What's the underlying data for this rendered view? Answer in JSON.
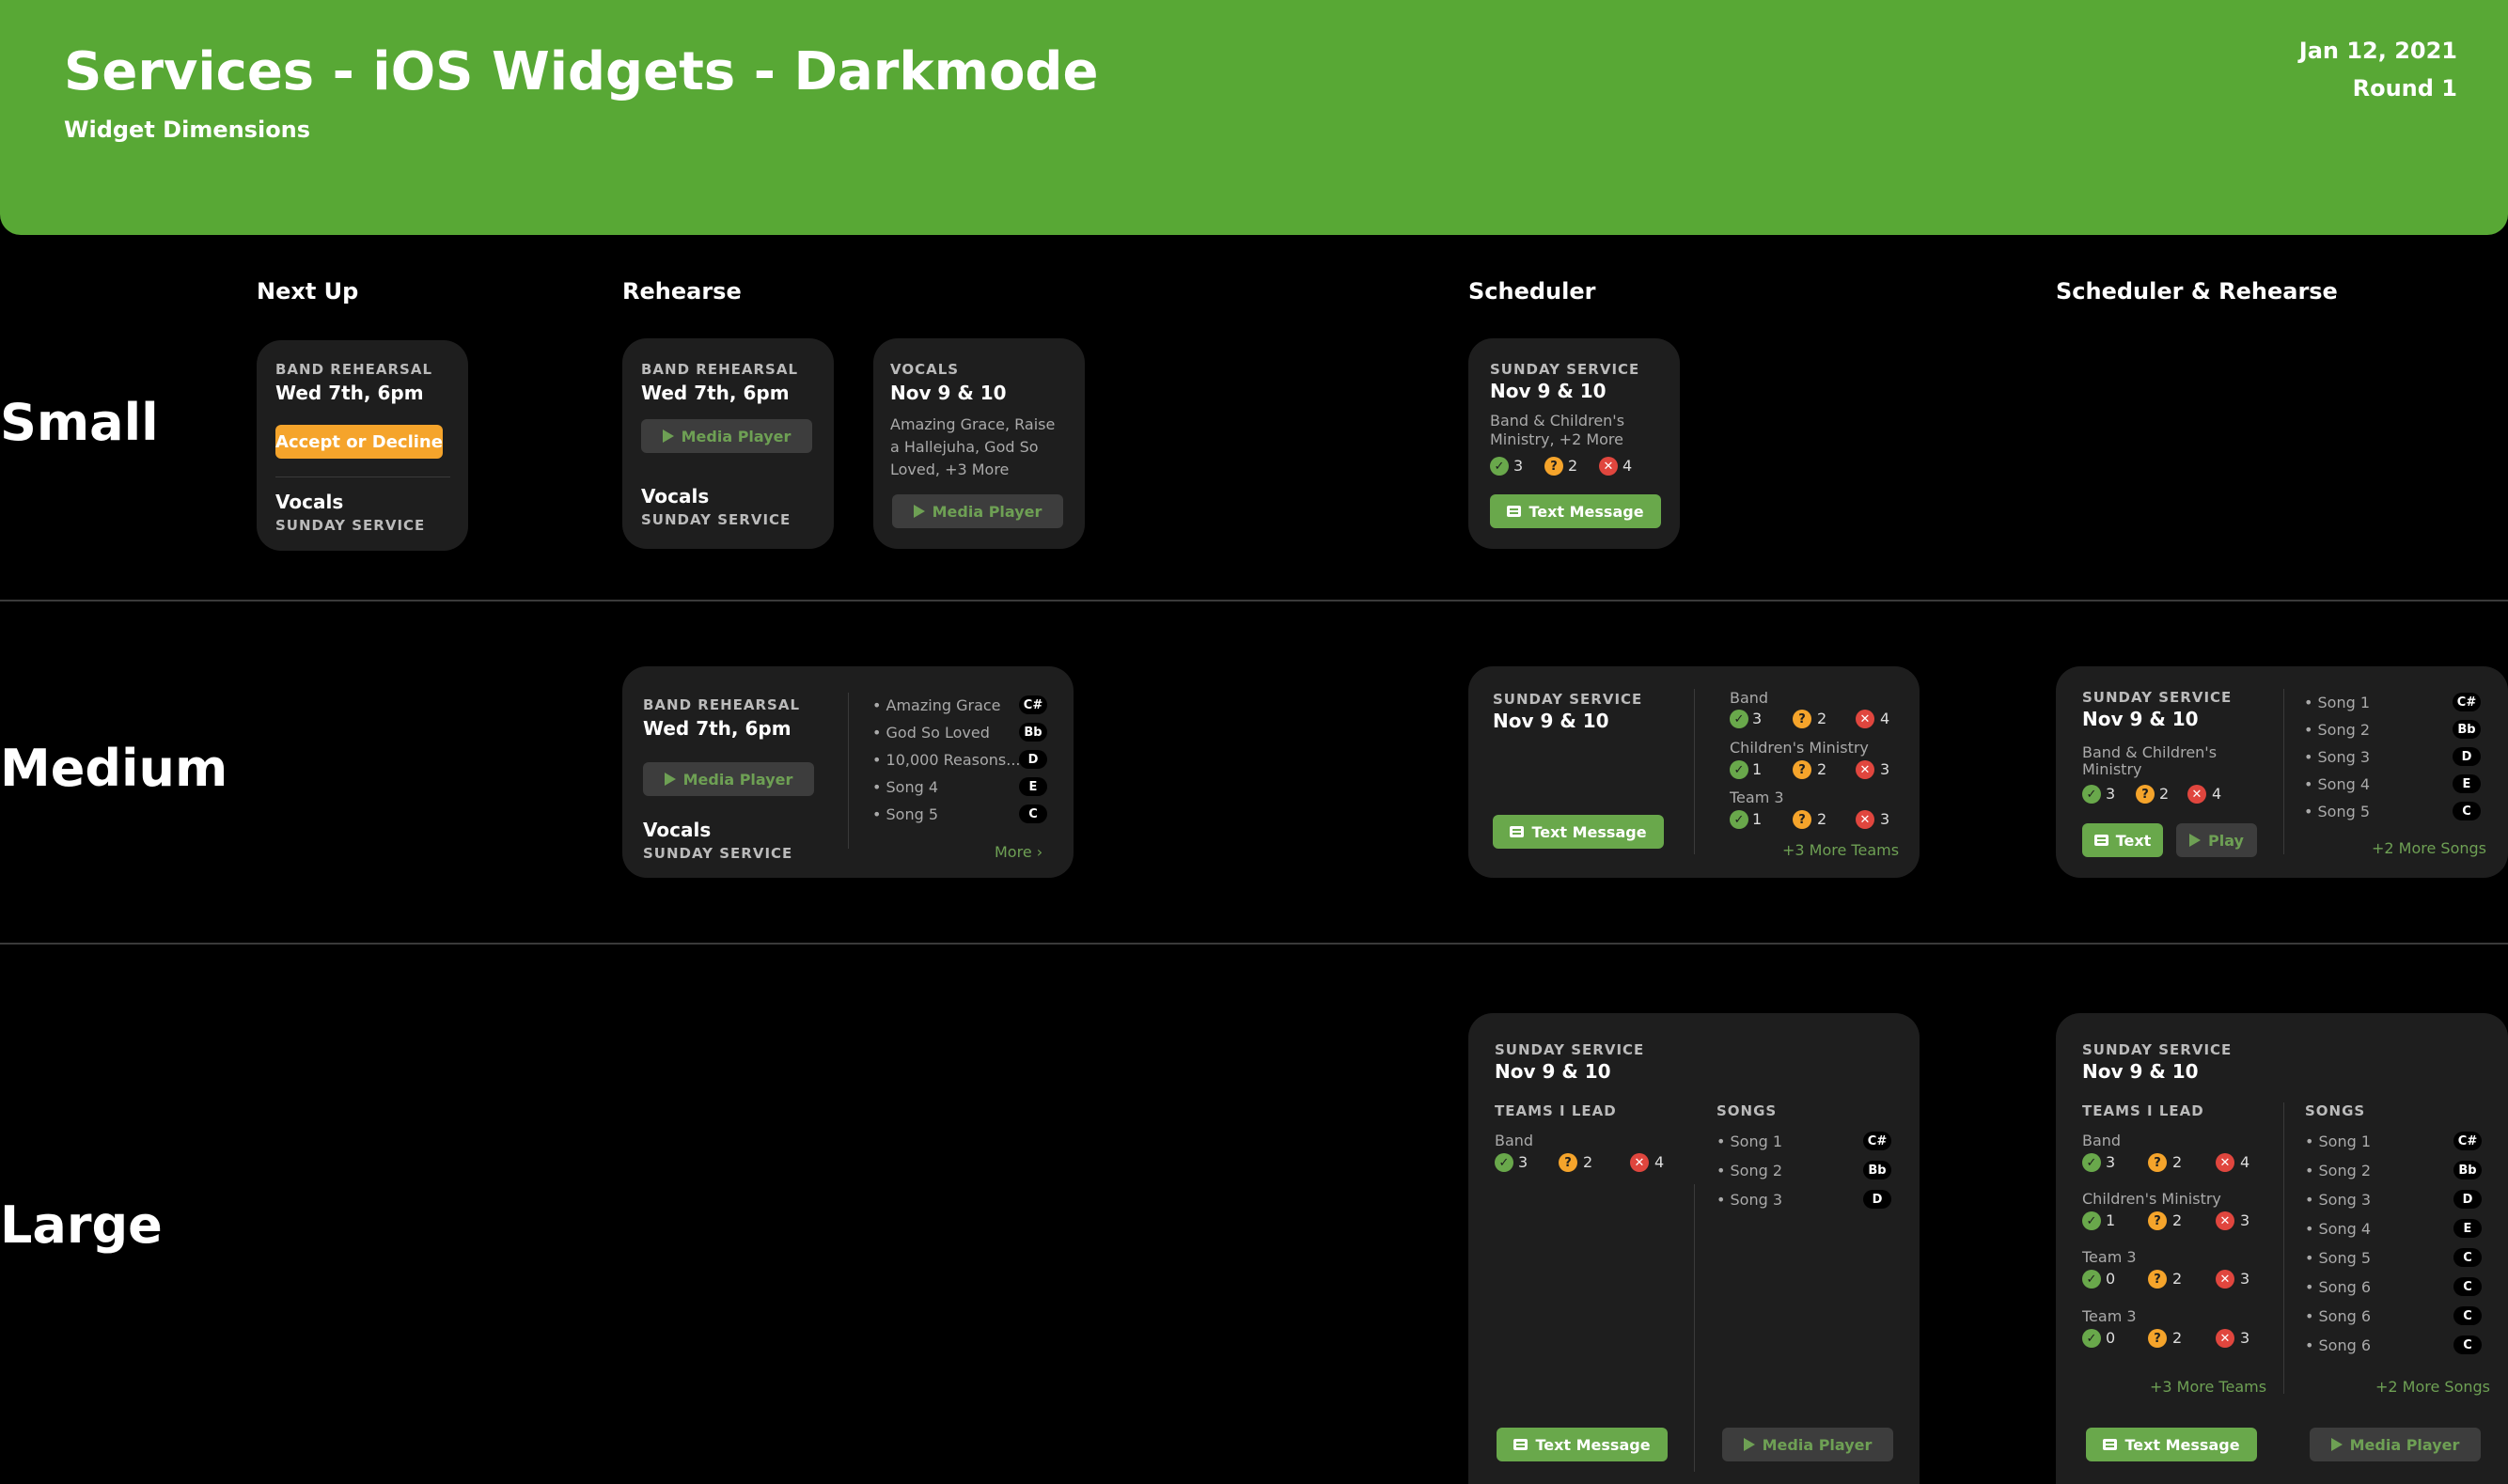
{
  "header": {
    "title": "Services - iOS Widgets - Darkmode",
    "subtitle": "Widget Dimensions",
    "date": "Jan 12, 2021",
    "round": "Round 1"
  },
  "columns": [
    "Next Up",
    "Rehearse",
    "Scheduler",
    "Scheduler & Rehearse"
  ],
  "rows": [
    "Small",
    "Medium",
    "Large"
  ],
  "colors": {
    "brand_green": "#58a835",
    "button_green": "#69a84b",
    "warning_orange": "#f5a42b",
    "decline_red": "#e0463e",
    "widget_bg": "#1e1e1e"
  },
  "icons": [
    "check-icon",
    "question-icon",
    "x-icon",
    "play-icon",
    "message-icon",
    "chevron-right-icon"
  ],
  "small": {
    "next_up": {
      "overline": "BAND REHEARSAL",
      "time": "Wed 7th, 6pm",
      "button": "Accept or Decline",
      "team": "Vocals",
      "service": "SUNDAY SERVICE"
    },
    "rehearse_a": {
      "overline": "BAND REHEARSAL",
      "time": "Wed 7th, 6pm",
      "button": "Media Player",
      "team": "Vocals",
      "service": "SUNDAY SERVICE"
    },
    "rehearse_b": {
      "overline": "VOCALS",
      "date": "Nov 9 & 10",
      "songs": [
        "Amazing Grace, Raise",
        "a Hallejuha, God So",
        "Loved, +3 More"
      ],
      "button": "Media Player"
    },
    "scheduler": {
      "overline": "SUNDAY SERVICE",
      "date": "Nov 9 & 10",
      "teams": [
        "Band & Children's",
        "Ministry, +2 More"
      ],
      "confirmed": "3",
      "pending": "2",
      "declined": "4",
      "button": "Text Message"
    }
  },
  "medium": {
    "rehearse": {
      "overline": "BAND REHEARSAL",
      "time": "Wed 7th, 6pm",
      "button": "Media Player",
      "team": "Vocals",
      "service": "SUNDAY SERVICE",
      "songs": [
        {
          "name": "• Amazing Grace",
          "key": "C#"
        },
        {
          "name": "• God So Loved",
          "key": "Bb"
        },
        {
          "name": "• 10,000 Reasons...",
          "key": "D"
        },
        {
          "name": "• Song 4",
          "key": "E"
        },
        {
          "name": "• Song 5",
          "key": "C"
        }
      ],
      "more": "More"
    },
    "scheduler": {
      "overline": "SUNDAY SERVICE",
      "date": "Nov 9 & 10",
      "button": "Text Message",
      "teams": [
        {
          "name": "Band",
          "c": "3",
          "p": "2",
          "d": "4"
        },
        {
          "name": "Children's Ministry",
          "c": "1",
          "p": "2",
          "d": "3"
        },
        {
          "name": "Team 3",
          "c": "1",
          "p": "2",
          "d": "3"
        }
      ],
      "more": "+3 More Teams"
    },
    "sched_reh": {
      "overline": "SUNDAY SERVICE",
      "date": "Nov 9 & 10",
      "teams": [
        "Band & Children's",
        "Ministry"
      ],
      "c": "3",
      "p": "2",
      "d": "4",
      "text_button": "Text",
      "play_button": "Play",
      "songs": [
        {
          "name": "• Song 1",
          "key": "C#"
        },
        {
          "name": "• Song 2",
          "key": "Bb"
        },
        {
          "name": "• Song 3",
          "key": "D"
        },
        {
          "name": "• Song 4",
          "key": "E"
        },
        {
          "name": "• Song 5",
          "key": "C"
        }
      ],
      "more": "+2 More Songs"
    }
  },
  "large": {
    "scheduler": {
      "overline": "SUNDAY SERVICE",
      "date": "Nov 9 & 10",
      "teams_label": "TEAMS I LEAD",
      "songs_label": "SONGS",
      "teams": [
        {
          "name": "Band",
          "c": "3",
          "p": "2",
          "d": "4"
        }
      ],
      "songs": [
        {
          "name": "• Song 1",
          "key": "C#"
        },
        {
          "name": "• Song 2",
          "key": "Bb"
        },
        {
          "name": "• Song 3",
          "key": "D"
        }
      ],
      "text_button": "Text Message",
      "media_button": "Media Player"
    },
    "sched_reh": {
      "overline": "SUNDAY SERVICE",
      "date": "Nov 9 & 10",
      "teams_label": "TEAMS I LEAD",
      "songs_label": "SONGS",
      "teams": [
        {
          "name": "Band",
          "c": "3",
          "p": "2",
          "d": "4"
        },
        {
          "name": "Children's Ministry",
          "c": "1",
          "p": "2",
          "d": "3"
        },
        {
          "name": "Team 3",
          "c": "0",
          "p": "2",
          "d": "3"
        },
        {
          "name": "Team 3",
          "c": "0",
          "p": "2",
          "d": "3"
        }
      ],
      "songs": [
        {
          "name": "• Song 1",
          "key": "C#"
        },
        {
          "name": "• Song 2",
          "key": "Bb"
        },
        {
          "name": "• Song 3",
          "key": "D"
        },
        {
          "name": "• Song 4",
          "key": "E"
        },
        {
          "name": "• Song 5",
          "key": "C"
        },
        {
          "name": "• Song 6",
          "key": "C"
        },
        {
          "name": "• Song 6",
          "key": "C"
        },
        {
          "name": "• Song 6",
          "key": "C"
        }
      ],
      "more_teams": "+3 More Teams",
      "more_songs": "+2 More Songs",
      "text_button": "Text Message",
      "media_button": "Media Player"
    }
  }
}
